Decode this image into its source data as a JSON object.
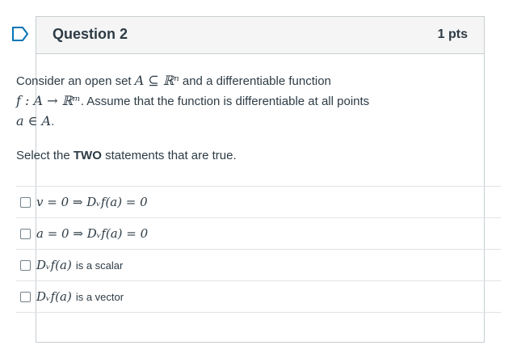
{
  "question": {
    "title": "Question 2",
    "points": "1 pts",
    "intro_before": "Consider an open set",
    "set_expr": "A ⊆ ℝⁿ",
    "intro_mid": "and a differentiable function",
    "func_expr": "f : A → ℝᵐ",
    "intro_after": ". Assume that the function is differentiable at all points",
    "point_expr": "a ∈ A",
    "intro_end": ".",
    "prompt_before": "Select the",
    "prompt_bold": "TWO",
    "prompt_after": "statements that are true."
  },
  "answers": [
    {
      "math": "v = 0 ⇒ Dᵥf(a) = 0",
      "text": ""
    },
    {
      "math": "a = 0 ⇒ Dᵥf(a) = 0",
      "text": ""
    },
    {
      "math": "Dᵥf(a)",
      "text": "is a scalar"
    },
    {
      "math": "Dᵥf(a)",
      "text": "is a vector"
    }
  ],
  "colors": {
    "accent": "#0374b5",
    "text": "#2d3b45",
    "border": "#c7cdd1",
    "header_bg": "#f5f5f5"
  },
  "icons": {
    "flag": "question-flag-icon"
  }
}
